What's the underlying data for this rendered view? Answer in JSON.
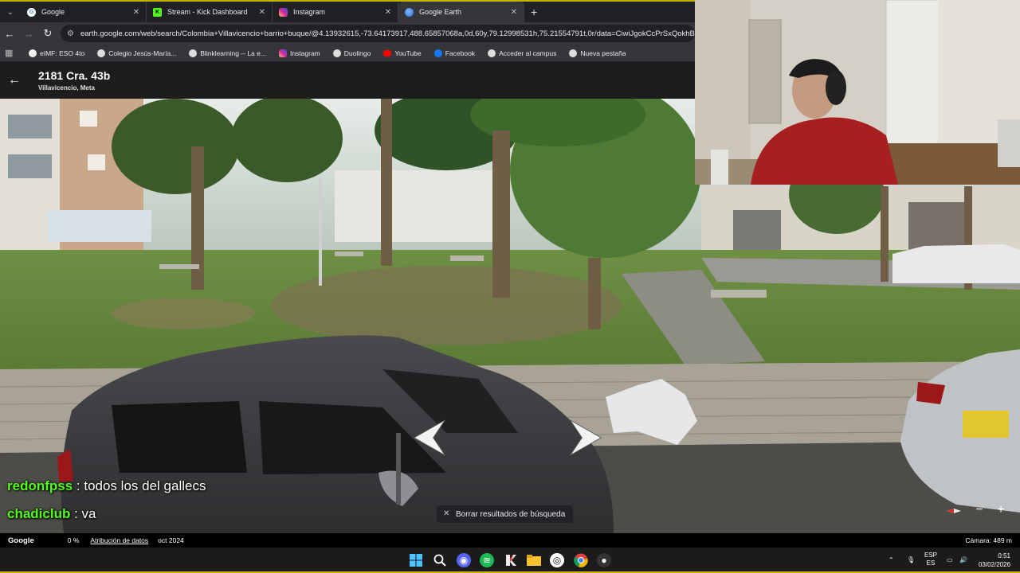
{
  "browser": {
    "tabs": [
      {
        "label": "Google",
        "favicon_color": "#ffffff",
        "favicon_char": "G",
        "favicon_text_color": "#4285f4"
      },
      {
        "label": "Stream - Kick Dashboard",
        "favicon_color": "#53fc18",
        "favicon_char": "K",
        "favicon_text_color": "#000000"
      },
      {
        "label": "Instagram",
        "favicon_color": "#d6249f",
        "favicon_char": "",
        "favicon_text_color": "#ffffff"
      },
      {
        "label": "Google Earth",
        "favicon_color": "#4285f4",
        "favicon_char": "",
        "favicon_text_color": "#ffffff",
        "active": true
      }
    ],
    "url": "earth.google.com/web/search/Colombia+Villavicencio+barrio+buque/@4.13932615,-73.64173917,488.65857068a,0d,60y,79.12998531h,75.21554791t,0r/data=CiwiJgokCcPrSxQokhBAEV",
    "bookmarks": [
      {
        "label": "eIMF: ESO 4to",
        "color": "#f2f2f2"
      },
      {
        "label": "Colegio Jesús-María...",
        "color": "#dddddd"
      },
      {
        "label": "Blinklearning -- La e...",
        "color": "#dddddd"
      },
      {
        "label": "Instagram",
        "color": "#d6249f"
      },
      {
        "label": "Duolingo",
        "color": "#dddddd"
      },
      {
        "label": "YouTube",
        "color": "#ff0000"
      },
      {
        "label": "Facebook",
        "color": "#1877f2"
      },
      {
        "label": "Acceder al campus",
        "color": "#dddddd"
      },
      {
        "label": "Nueva pestaña",
        "color": "#dddddd"
      }
    ]
  },
  "earth": {
    "address": "2181 Cra. 43b",
    "city": "Villavicencio, Meta",
    "clear_search": "Borrar resultados de búsqueda",
    "zoom_out": "−",
    "zoom_in": "+"
  },
  "chat": [
    {
      "user": "redonfpss",
      "message": ": todos los del gallecs"
    },
    {
      "user": "chadiclub",
      "message": ": va"
    }
  ],
  "statusbar": {
    "logo": "Google",
    "percent": "0 %",
    "attribution": "Atribución de datos",
    "date": "oct 2024",
    "camera": "Cámara: 489 m"
  },
  "taskbar": {
    "lang_top": "ESP",
    "lang_bottom": "ES",
    "time": "0:51",
    "date": "03/02/2026"
  },
  "icons": {
    "back": "back-arrow-icon",
    "forward": "forward-arrow-icon",
    "reload": "reload-icon",
    "windows": "windows-start-icon",
    "search": "search-icon"
  }
}
